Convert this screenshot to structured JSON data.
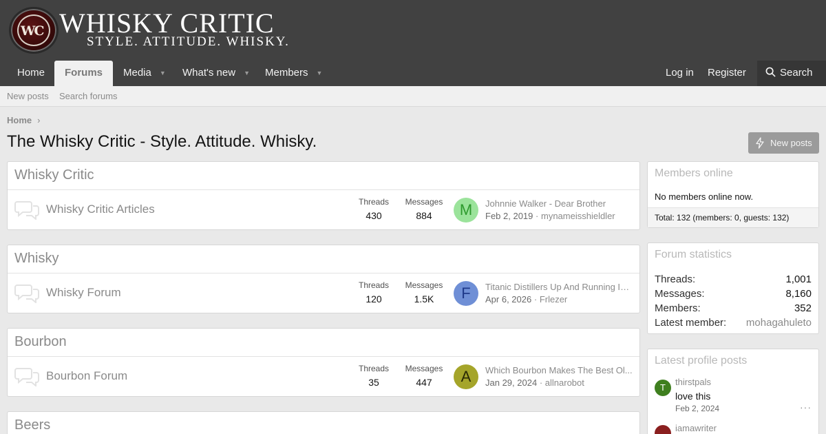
{
  "brand": {
    "monogram": "WC",
    "title": "WHISKY CRITIC",
    "tagline": "STYLE. ATTITUDE. WHISKY."
  },
  "nav": {
    "home": "Home",
    "forums": "Forums",
    "media": "Media",
    "whats_new": "What's new",
    "members": "Members",
    "login": "Log in",
    "register": "Register",
    "search": "Search",
    "caret_icon": "chevron-down-icon",
    "search_icon": "search-icon"
  },
  "subnav": {
    "new_posts": "New posts",
    "search_forums": "Search forums"
  },
  "breadcrumb": {
    "home": "Home",
    "separator": "›"
  },
  "page": {
    "title": "The Whisky Critic - Style. Attitude. Whisky.",
    "new_posts_button": "New posts"
  },
  "categories": [
    {
      "title": "Whisky Critic",
      "forum": {
        "title": "Whisky Critic Articles",
        "threads_label": "Threads",
        "threads": "430",
        "messages_label": "Messages",
        "messages": "884",
        "last_post": {
          "avatar_letter": "M",
          "avatar_bg": "#9be39b",
          "avatar_fg": "#2e9a2e",
          "title": "Johnnie Walker - Dear Brother",
          "date": "Feb 2, 2019",
          "separator": "·",
          "user": "mynameisshieldler"
        }
      }
    },
    {
      "title": "Whisky",
      "forum": {
        "title": "Whisky Forum",
        "threads_label": "Threads",
        "threads": "120",
        "messages_label": "Messages",
        "messages": "1.5K",
        "last_post": {
          "avatar_letter": "F",
          "avatar_bg": "#6f8fd6",
          "avatar_fg": "#1f3a8a",
          "title": "Titanic Distillers Up And Running In ...",
          "date": "Apr 6, 2026",
          "separator": "·",
          "user": "Frlezer"
        }
      }
    },
    {
      "title": "Bourbon",
      "forum": {
        "title": "Bourbon Forum",
        "threads_label": "Threads",
        "threads": "35",
        "messages_label": "Messages",
        "messages": "447",
        "last_post": {
          "avatar_letter": "A",
          "avatar_bg": "#a5a52a",
          "avatar_fg": "#2a2a05",
          "title": "Which Bourbon Makes The Best Ol...",
          "date": "Jan 29, 2024",
          "separator": "·",
          "user": "allnarobot"
        }
      }
    },
    {
      "title": "Beers"
    }
  ],
  "sidebar": {
    "members_online": {
      "title": "Members online",
      "text": "No members online now.",
      "total": "Total: 132 (members: 0, guests: 132)"
    },
    "forum_statistics": {
      "title": "Forum statistics",
      "rows": [
        {
          "label": "Threads:",
          "value": "1,001"
        },
        {
          "label": "Messages:",
          "value": "8,160"
        },
        {
          "label": "Members:",
          "value": "352"
        },
        {
          "label": "Latest member:",
          "value": "mohagahuleto"
        }
      ]
    },
    "profile_posts": {
      "title": "Latest profile posts",
      "posts": [
        {
          "avatar_letter": "T",
          "avatar_bg": "#3f7f1f",
          "user": "thirstpals",
          "text": "love this",
          "date": "Feb 2, 2024",
          "more": "···"
        },
        {
          "avatar_letter": "",
          "avatar_bg": "#8a1f1f",
          "user": "iamawriter"
        }
      ]
    }
  },
  "colors": {
    "header_bg": "#414141",
    "body_bg": "#e9e9e9",
    "link_muted": "#8a8a8a"
  }
}
